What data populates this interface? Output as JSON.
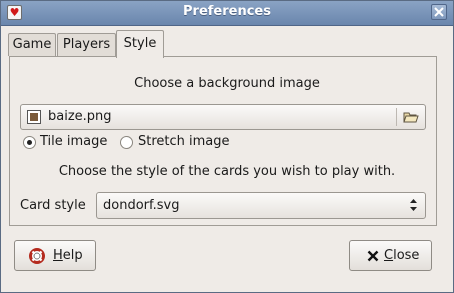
{
  "window": {
    "title": "Preferences"
  },
  "tabs": [
    {
      "label": "Game"
    },
    {
      "label": "Players"
    },
    {
      "label": "Style",
      "active": true
    }
  ],
  "style_tab": {
    "background_heading": "Choose a background image",
    "background_file": "baize.png",
    "tile_label": "Tile image",
    "stretch_label": "Stretch image",
    "selected_mode": "tile",
    "cards_heading": "Choose the style of the cards you wish to play with.",
    "card_style_label": "Card style",
    "card_style_value": "dondorf.svg"
  },
  "buttons": {
    "help_first": "H",
    "help_rest": "elp",
    "close_first": "C",
    "close_rest": "lose"
  },
  "icons": {
    "app": "playing-card-icon",
    "close_window": "close-icon",
    "file": "image-file-icon",
    "folder": "open-folder-icon",
    "combo": "up-down-arrows-icon",
    "help": "lifebuoy-icon",
    "close_button": "x-icon"
  }
}
